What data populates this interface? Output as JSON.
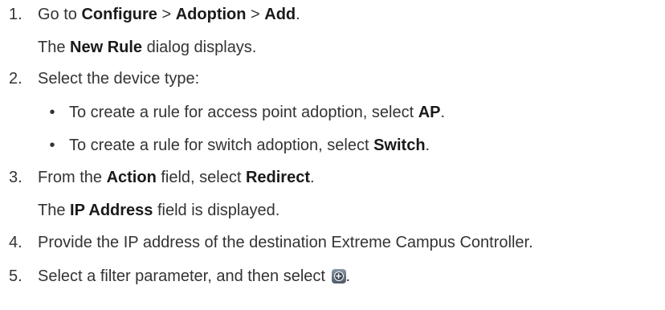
{
  "steps": [
    {
      "num": "1.",
      "segments": [
        {
          "t": "Go to ",
          "b": false
        },
        {
          "t": "Configure",
          "b": true
        },
        {
          "t": " > ",
          "b": false
        },
        {
          "t": "Adoption",
          "b": true
        },
        {
          "t": " > ",
          "b": false
        },
        {
          "t": "Add",
          "b": true
        },
        {
          "t": ".",
          "b": false
        }
      ],
      "result": [
        {
          "t": "The ",
          "b": false
        },
        {
          "t": "New Rule",
          "b": true
        },
        {
          "t": " dialog displays.",
          "b": false
        }
      ]
    },
    {
      "num": "2.",
      "segments": [
        {
          "t": "Select the device type:",
          "b": false
        }
      ],
      "bullets": [
        [
          {
            "t": "To create a rule for access point adoption, select ",
            "b": false
          },
          {
            "t": "AP",
            "b": true
          },
          {
            "t": ".",
            "b": false
          }
        ],
        [
          {
            "t": "To create a rule for switch adoption, select ",
            "b": false
          },
          {
            "t": "Switch",
            "b": true
          },
          {
            "t": ".",
            "b": false
          }
        ]
      ]
    },
    {
      "num": "3.",
      "segments": [
        {
          "t": "From the ",
          "b": false
        },
        {
          "t": "Action",
          "b": true
        },
        {
          "t": " field, select ",
          "b": false
        },
        {
          "t": "Redirect",
          "b": true
        },
        {
          "t": ".",
          "b": false
        }
      ],
      "result": [
        {
          "t": "The ",
          "b": false
        },
        {
          "t": "IP Address",
          "b": true
        },
        {
          "t": " field is displayed.",
          "b": false
        }
      ]
    },
    {
      "num": "4.",
      "segments": [
        {
          "t": "Provide the IP address of the destination Extreme Campus Controller.",
          "b": false
        }
      ]
    },
    {
      "num": "5.",
      "segments": [
        {
          "t": "Select a filter parameter, and then select ",
          "b": false
        }
      ],
      "icon": "add-circle-icon",
      "after_icon": "."
    }
  ],
  "bullet_glyph": "•"
}
